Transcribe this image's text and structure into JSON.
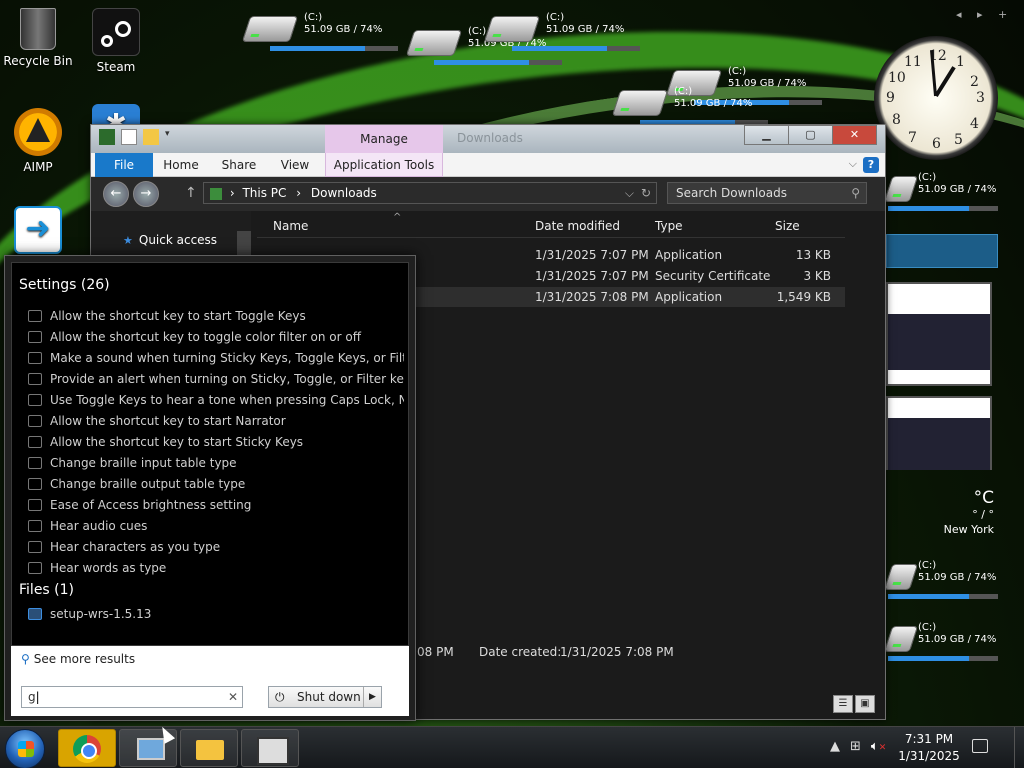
{
  "desktop": {
    "icons": [
      {
        "label": "Recycle Bin",
        "icon": "recycle-bin-icon"
      },
      {
        "label": "Steam",
        "icon": "steam-icon"
      },
      {
        "label": "AIMP",
        "icon": "aimp-icon"
      }
    ],
    "drive_label": "(C:)",
    "drive_usage": "51.09 GB / 74%",
    "drive_fill_pct": 74,
    "drive_label_partial": "(C:)",
    "drive_usage_partial": "51.09 GB / 74%"
  },
  "clock_gadget": {
    "numbers": [
      "12",
      "1",
      "2",
      "3",
      "4",
      "5",
      "6",
      "7",
      "8",
      "9",
      "10",
      "11"
    ]
  },
  "gadget_nav": "◂ ▸ +",
  "weather": {
    "temp": "°C",
    "range": "° / °",
    "city": "New York"
  },
  "explorer": {
    "title": "Downloads",
    "context_tab": "Manage",
    "ribbon_tabs": [
      "File",
      "Home",
      "Share",
      "View",
      "Application Tools"
    ],
    "breadcrumb_root": "This PC",
    "breadcrumb_sep": "›",
    "breadcrumb_current": "Downloads",
    "search_placeholder": "Search Downloads",
    "nav_quick_access": "Quick access",
    "columns": [
      "Name",
      "Date modified",
      "Type",
      "Size"
    ],
    "rows": [
      {
        "name": "",
        "date": "1/31/2025 7:07 PM",
        "type": "Application",
        "size": "13 KB"
      },
      {
        "name": "",
        "date": "1/31/2025 7:07 PM",
        "type": "Security Certificate",
        "size": "3 KB"
      },
      {
        "name": "",
        "date": "1/31/2025 7:08 PM",
        "type": "Application",
        "size": "1,549 KB"
      }
    ],
    "details": {
      "modified_tail": "08 PM",
      "created_label": "Date created:",
      "created_value": "1/31/2025 7:08 PM"
    }
  },
  "start_menu": {
    "settings_heading": "Settings (26)",
    "settings_items": [
      "Allow the shortcut key to start Toggle Keys",
      "Allow the shortcut key to toggle color filter on or off",
      "Make a sound when turning Sticky Keys, Toggle Keys, or Filter Ke...",
      "Provide an alert when turning on Sticky, Toggle, or Filter keys wit...",
      "Use Toggle Keys to hear a tone when pressing Caps Lock, Num L...",
      "Allow the shortcut key to start Narrator",
      "Allow the shortcut key to start Sticky Keys",
      "Change braille input table type",
      "Change braille output table type",
      "Ease of Access brightness setting",
      "Hear audio cues",
      "Hear characters as you type",
      "Hear words as type"
    ],
    "files_heading": "Files (1)",
    "files_items": [
      "setup-wrs-1.5.13"
    ],
    "see_more": "See more results",
    "search_value": "g",
    "shutdown_label": "Shut down"
  },
  "taskbar": {
    "time": "7:31 PM",
    "date": "1/31/2025",
    "pinned": [
      "start-orb",
      "chrome-icon",
      "network-icon",
      "file-explorer-icon",
      "document-icon"
    ]
  }
}
